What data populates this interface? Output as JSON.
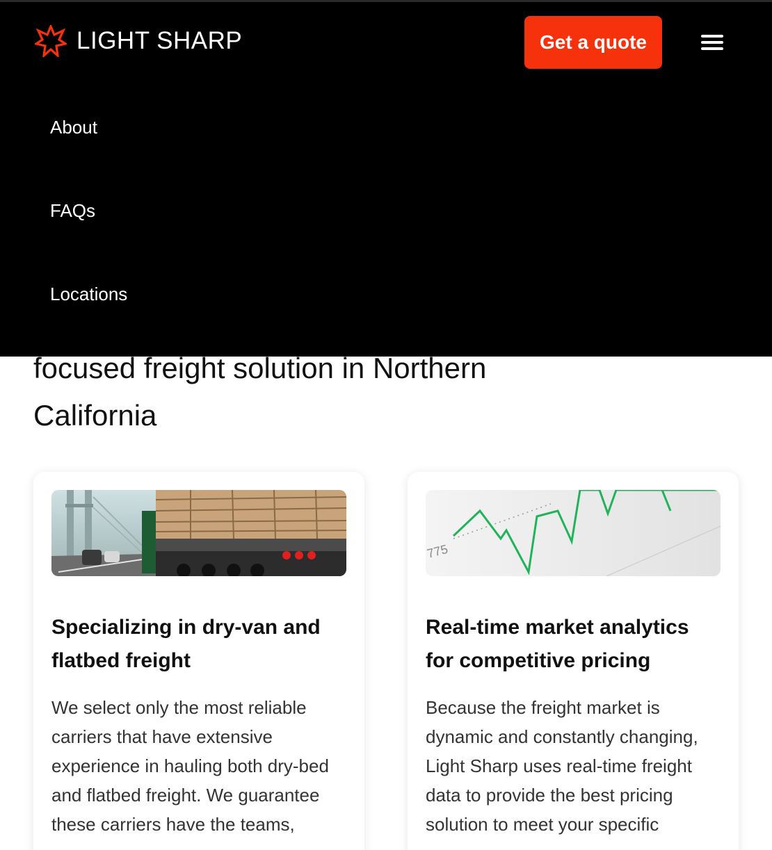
{
  "brand": {
    "name": "LIGHT SHARP",
    "accent_color": "#f5320c"
  },
  "header": {
    "quote_label": "Get a quote",
    "menu_icon": "hamburger-menu-icon"
  },
  "nav": {
    "items": [
      {
        "label": "About"
      },
      {
        "label": "FAQs"
      },
      {
        "label": "Locations"
      }
    ]
  },
  "hero": {
    "line1": "focused freight solution in Northern",
    "line2": "California"
  },
  "cards": [
    {
      "image": "flatbed-truck-lumber-bridge-image",
      "title_line1": "Specializing in dry-van and",
      "title_line2": "flatbed freight",
      "body_lines": [
        "We select only the most reliable",
        "carriers that have extensive",
        "experience in hauling both dry-bed",
        "and flatbed freight. We guarantee",
        "these carriers have the teams,"
      ]
    },
    {
      "image": "market-chart-line-image",
      "image_tick": "775",
      "title_line1": "Real-time market analytics",
      "title_line2": "for competitive pricing",
      "body_lines": [
        "Because the freight market is",
        "dynamic and constantly changing,",
        "Light Sharp uses real-time freight",
        "data to provide the best pricing",
        "solution to meet your specific"
      ]
    }
  ]
}
